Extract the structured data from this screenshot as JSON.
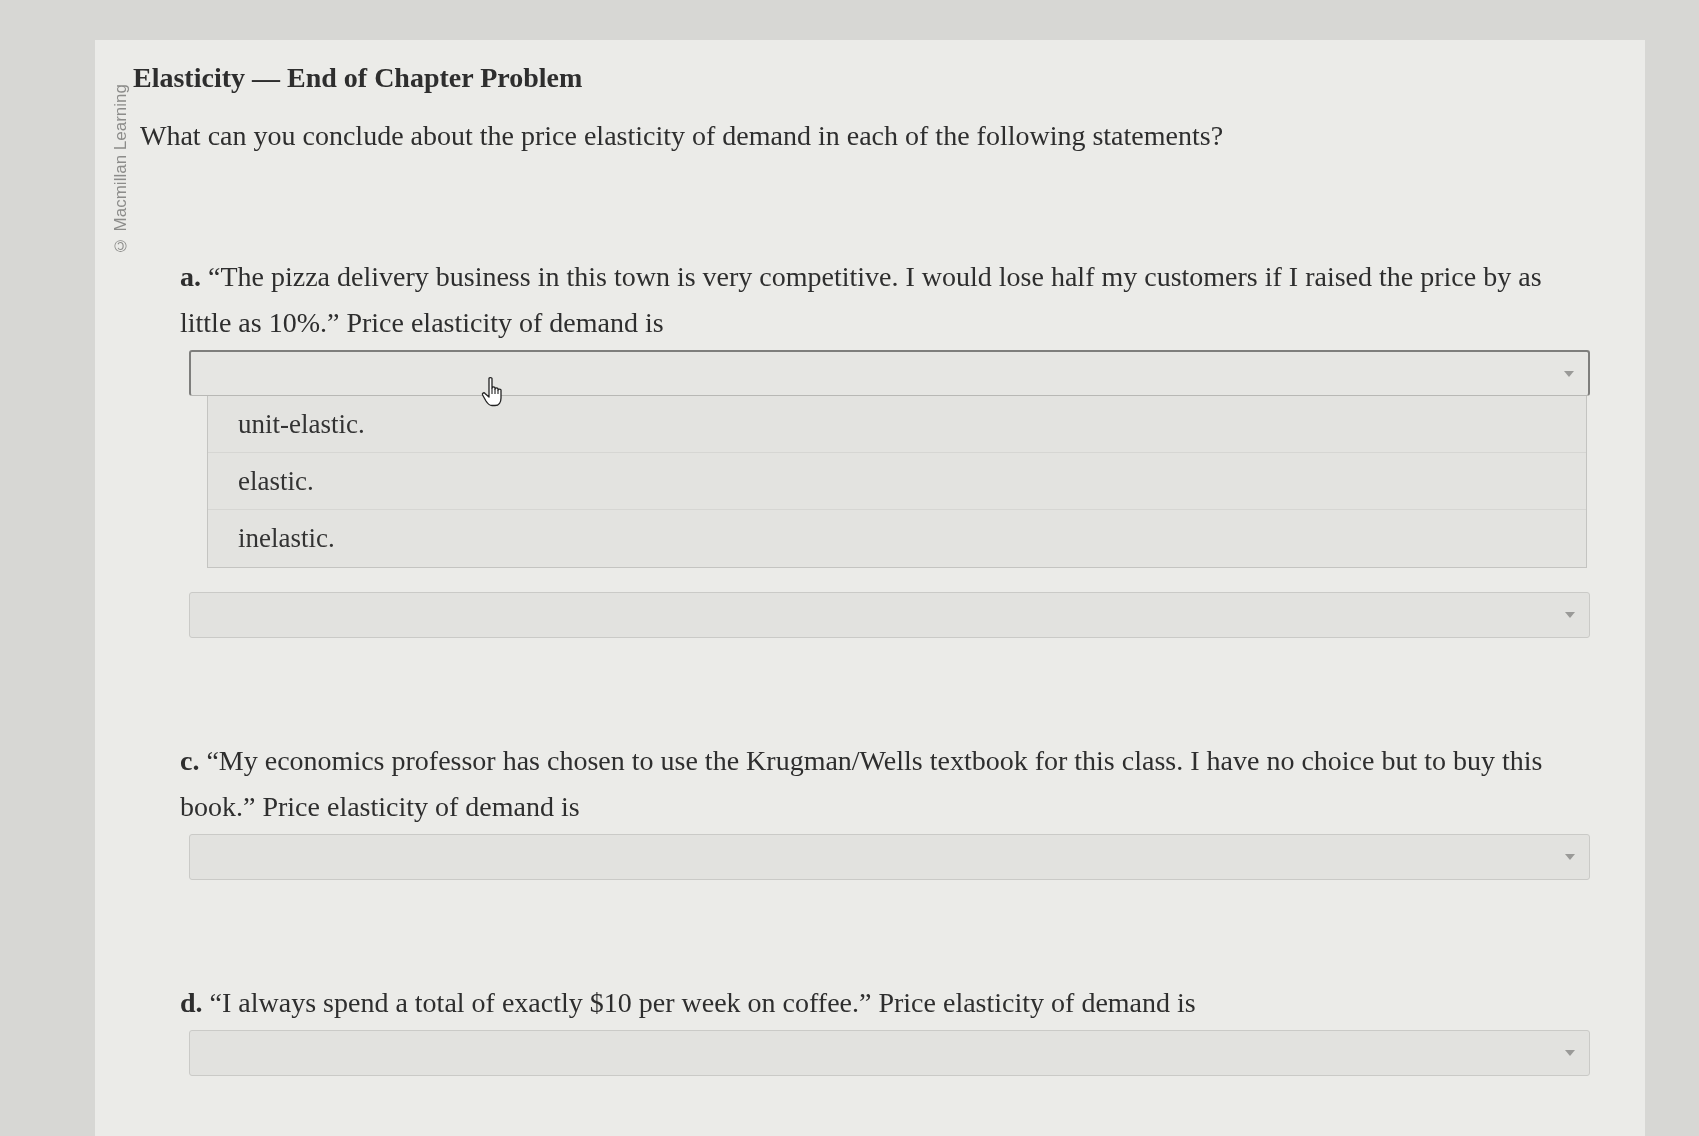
{
  "copyright": "© Macmillan Learning",
  "title": "Elasticity — End of Chapter Problem",
  "question": "What can you conclude about the price elasticity of demand in each of the following statements?",
  "items": [
    {
      "statement": "**a.** “The pizza delivery business in this town is very competitive. I would lose half my customers if I raised the price by as little as 10%.” Price elasticity of demand is",
      "dropdown": {
        "expanded": true,
        "options": [
          {
            "label": "unit-elastic.",
            "selected": false
          },
          {
            "label": "elastic.",
            "selected": false
          },
          {
            "label": "inelastic.",
            "selected": false
          }
        ]
      }
    },
    {
      "dropdown": {
        "expanded": false
      }
    },
    {
      "statement": "**c.** “My economics professor has chosen to use the Krugman/Wells textbook for this class. I have no choice but to buy this book.” Price elasticity of demand is",
      "dropdown": {
        "expanded": false
      }
    },
    {
      "statement": "**d.** “I always spend a total of exactly $10 per week on coffee.” Price elasticity of demand is",
      "dropdown": {
        "expanded": false
      }
    }
  ]
}
